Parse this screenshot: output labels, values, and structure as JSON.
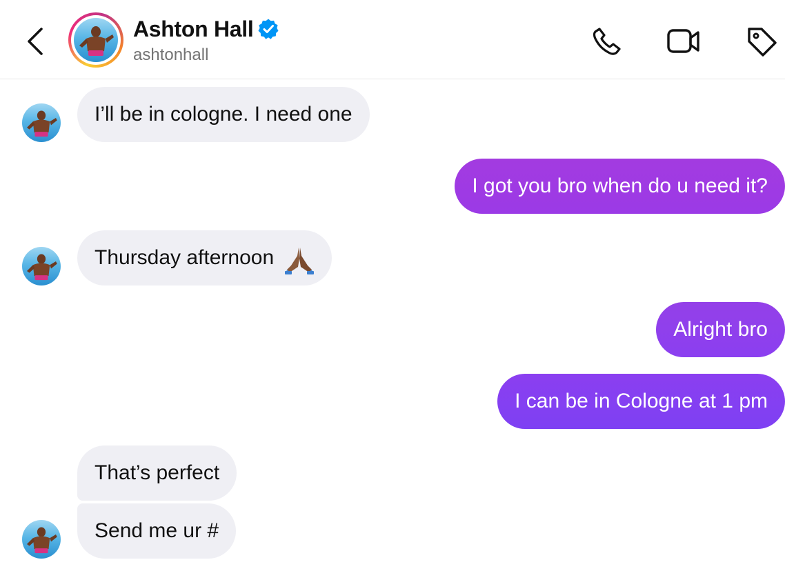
{
  "header": {
    "contact_name": "Ashton Hall",
    "username": "ashtonhall",
    "verified": true,
    "icons": {
      "back": "chevron-left-icon",
      "call": "phone-icon",
      "video": "video-camera-icon",
      "tag": "tag-icon",
      "verified": "verified-badge-icon"
    }
  },
  "messages": [
    {
      "side": "received",
      "text": "I’ll be in cologne. I need one",
      "show_avatar": true
    },
    {
      "side": "sent",
      "text": "I got you bro when do u need it?"
    },
    {
      "side": "received",
      "text": "Thursday afternoon",
      "emoji": "folded-hands-emoji",
      "show_avatar": true
    },
    {
      "side": "sent",
      "text": "Alright bro"
    },
    {
      "side": "sent",
      "text": "I can be in Cologne at 1 pm"
    },
    {
      "side": "received",
      "text": "That’s perfect",
      "show_avatar": false
    },
    {
      "side": "received",
      "text": "Send me ur #",
      "show_avatar": true
    }
  ],
  "colors": {
    "sent_bubble_top": "#a33be0",
    "sent_bubble_bottom": "#7b3ff2",
    "received_bubble": "#efeff4",
    "verified_blue": "#0095f6",
    "username_gray": "#737373"
  }
}
